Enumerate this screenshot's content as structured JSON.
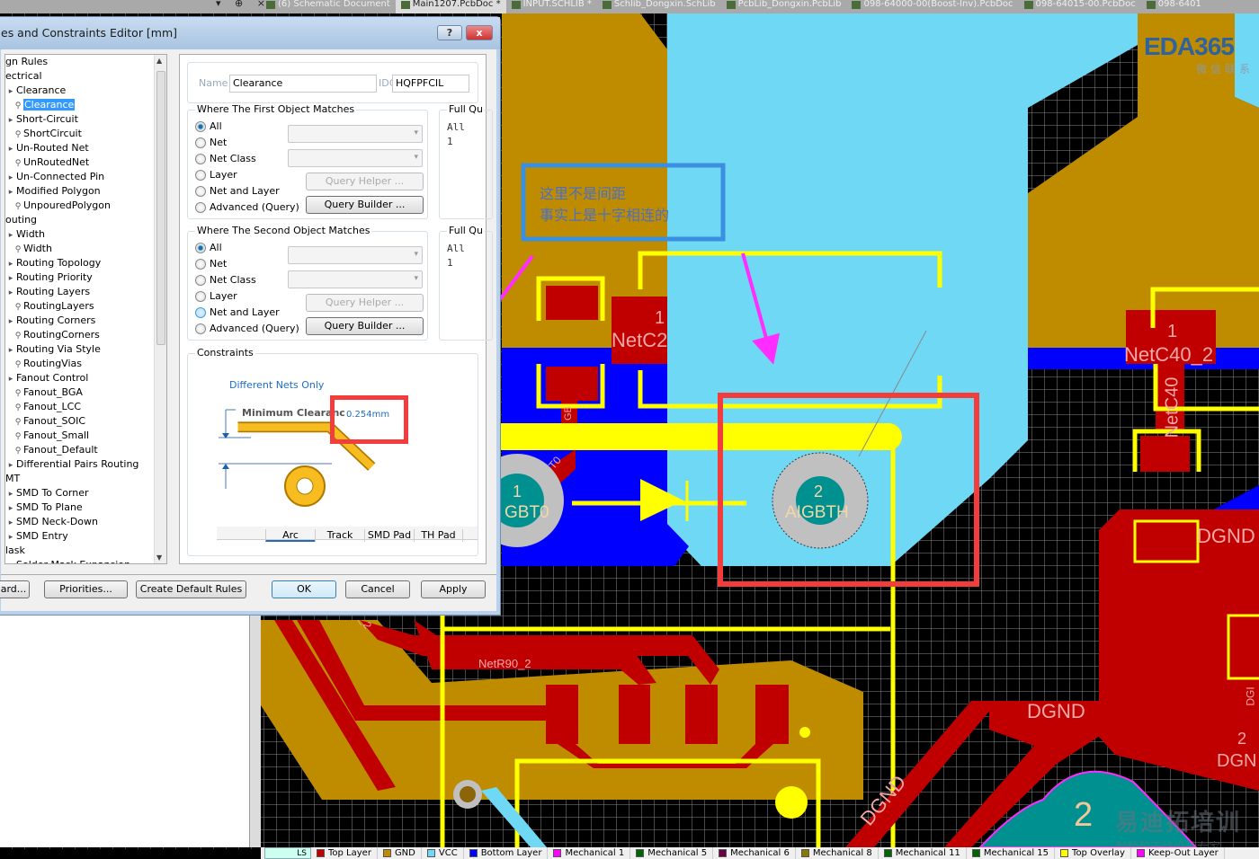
{
  "tabbar": {
    "panel_controls": "▾ ⊕ ×",
    "tabs": [
      {
        "label": "(6) Schematic Document",
        "icon": "schematic-icon"
      },
      {
        "label": "Main1207.PcbDoc *",
        "icon": "pcb-icon",
        "active": true
      },
      {
        "label": "INPUT.SCHLIB *",
        "icon": "schlib-icon"
      },
      {
        "label": "Schlib_Dongxin.SchLib",
        "icon": "schlib-icon"
      },
      {
        "label": "PcbLib_Dongxin.PcbLib",
        "icon": "pcblib-icon"
      },
      {
        "label": "098-64000-00(Boost-Inv).PcbDoc",
        "icon": "pcb-icon"
      },
      {
        "label": "098-64015-00.PcbDoc",
        "icon": "pcb-icon"
      },
      {
        "label": "098-6401",
        "icon": "pcb-icon"
      }
    ]
  },
  "dialog": {
    "title": "es and Constraints Editor [mm]",
    "help_label": "?",
    "close_label": "x",
    "tree": [
      {
        "label": "gn Rules",
        "level": 0
      },
      {
        "label": "ectrical",
        "level": 0
      },
      {
        "label": "Clearance",
        "level": 1
      },
      {
        "label": "Clearance",
        "level": 2,
        "selected": true
      },
      {
        "label": "Short-Circuit",
        "level": 1
      },
      {
        "label": "ShortCircuit",
        "level": 2
      },
      {
        "label": "Un-Routed Net",
        "level": 1
      },
      {
        "label": "UnRoutedNet",
        "level": 2
      },
      {
        "label": "Un-Connected Pin",
        "level": 1
      },
      {
        "label": "Modified Polygon",
        "level": 1
      },
      {
        "label": "UnpouredPolygon",
        "level": 2
      },
      {
        "label": "outing",
        "level": 0
      },
      {
        "label": "Width",
        "level": 1
      },
      {
        "label": "Width",
        "level": 2
      },
      {
        "label": "Routing Topology",
        "level": 1
      },
      {
        "label": "Routing Priority",
        "level": 1
      },
      {
        "label": "Routing Layers",
        "level": 1
      },
      {
        "label": "RoutingLayers",
        "level": 2
      },
      {
        "label": "Routing Corners",
        "level": 1
      },
      {
        "label": "RoutingCorners",
        "level": 2
      },
      {
        "label": "Routing Via Style",
        "level": 1
      },
      {
        "label": "RoutingVias",
        "level": 2
      },
      {
        "label": "Fanout Control",
        "level": 1
      },
      {
        "label": "Fanout_BGA",
        "level": 2
      },
      {
        "label": "Fanout_LCC",
        "level": 2
      },
      {
        "label": "Fanout_SOIC",
        "level": 2
      },
      {
        "label": "Fanout_Small",
        "level": 2
      },
      {
        "label": "Fanout_Default",
        "level": 2
      },
      {
        "label": "Differential Pairs Routing",
        "level": 1
      },
      {
        "label": "MT",
        "level": 0
      },
      {
        "label": "SMD To Corner",
        "level": 1
      },
      {
        "label": "SMD To Plane",
        "level": 1
      },
      {
        "label": "SMD Neck-Down",
        "level": 1
      },
      {
        "label": "SMD Entry",
        "level": 1
      },
      {
        "label": "lask",
        "level": 0
      },
      {
        "label": "Solder Mask Expansion",
        "level": 1
      }
    ],
    "name_label": "Name",
    "name_value": "Clearance",
    "id_label": "IDC",
    "id_value": "HQFPFCIL",
    "first": {
      "title": "Where The First Object Matches",
      "options": [
        "All",
        "Net",
        "Net Class",
        "Layer",
        "Net and Layer",
        "Advanced (Query)"
      ],
      "selected": "All",
      "query_helper": "Query Helper ...",
      "query_builder": "Query Builder ...",
      "full_query_title": "Full Qu",
      "full_query": [
        "All",
        "1"
      ]
    },
    "second": {
      "title": "Where The Second Object Matches",
      "options": [
        "All",
        "Net",
        "Net Class",
        "Layer",
        "Net and Layer",
        "Advanced (Query)"
      ],
      "selected": "All",
      "hovered": "Net and Layer",
      "query_helper": "Query Helper ...",
      "query_builder": "Query Builder ...",
      "full_query_title": "Full Qu",
      "full_query": [
        "All",
        "1"
      ]
    },
    "constraints": {
      "title": "Constraints",
      "scope": "Different Nets Only",
      "min_label": "Minimum Clearanc",
      "min_value": "0.254mm",
      "columns": [
        "Arc",
        "Track",
        "SMD Pad",
        "TH Pad"
      ]
    },
    "buttons": {
      "wizard": "ard...",
      "priorities": "Priorities...",
      "create_default": "Create Default Rules",
      "ok": "OK",
      "cancel": "Cancel",
      "apply": "Apply"
    }
  },
  "pcb": {
    "annotation": [
      "这里不是间距",
      "事实上是十字相连的"
    ],
    "labels": {
      "netc2_pin": "1",
      "netc2": "NetC2",
      "gbt_small": "GB",
      "t0": "T0",
      "left_pad_num": "1",
      "left_pad_net": "GBT0",
      "right_pad_num": "2",
      "right_pad_net": "AIGBTH",
      "netc40_pin": "1",
      "netc40": "NetC40_2",
      "netc40_v": "NetC40",
      "dgnd1": "DGND",
      "dgnd2": "DGND",
      "dgnd3": "DGND",
      "dgnd_pin": "2",
      "dgnd4": "DGN",
      "dgnd_v": "DGI",
      "netr90": "NetR90_2",
      "r2": "_2",
      "big_pad": "2"
    },
    "logo": {
      "text": "EDA365",
      "sub": "微信联系"
    },
    "watermark": {
      "title": "易迪拓培训",
      "sub": "射频和天线设计专家"
    },
    "colors": {
      "top_layer": "#c00000",
      "gnd": "#bf8c00",
      "vcc": "#6fd9f5",
      "bottom_layer": "#0000ff",
      "overlay": "#ffff00",
      "highlight_red": "#f33c3c",
      "annotation_blue": "#3a8fe0",
      "arrow": "#ff2dff"
    }
  },
  "layerbar": {
    "ls_label": "LS",
    "layers": [
      {
        "name": "Top Layer",
        "color": "#c00000"
      },
      {
        "name": "GND",
        "color": "#bf8c00"
      },
      {
        "name": "VCC",
        "color": "#6fd9f5"
      },
      {
        "name": "Bottom Layer",
        "color": "#0000ff"
      },
      {
        "name": "Mechanical 1",
        "color": "#ff00ff"
      },
      {
        "name": "Mechanical 5",
        "color": "#006400"
      },
      {
        "name": "Mechanical 6",
        "color": "#6b0040"
      },
      {
        "name": "Mechanical 8",
        "color": "#8b7a00"
      },
      {
        "name": "Mechanical 11",
        "color": "#006400"
      },
      {
        "name": "Mechanical 15",
        "color": "#006400"
      },
      {
        "name": "Top Overlay",
        "color": "#ffff00"
      },
      {
        "name": "Keep-Out Layer",
        "color": "#ff00ff"
      }
    ]
  }
}
